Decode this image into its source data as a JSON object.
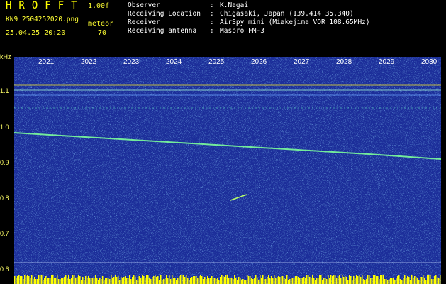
{
  "header": {
    "app_title": "HROFFT",
    "version": "1.00f",
    "filename": "KN9_2504252020.png",
    "meteor_label": "meteor",
    "datetime": "25.04.25 20:20",
    "meteor_count": "70"
  },
  "info": [
    {
      "key": "Observer",
      "sep": ":",
      "value": "K.Nagai"
    },
    {
      "key": "Receiving Location",
      "sep": ":",
      "value": "Chigasaki, Japan (139.414 35.340)"
    },
    {
      "key": "Receiver",
      "sep": ":",
      "value": "AirSpy mini (Miakejima VOR 108.65MHz)"
    },
    {
      "key": "Receiving antenna",
      "sep": ":",
      "value": "Maspro FM-3"
    }
  ],
  "axis": {
    "unit": "kHz",
    "y_ticks": [
      "1.1",
      "1.0",
      "0.9",
      "0.8",
      "0.7",
      "0.6"
    ],
    "x_ticks": [
      "2021",
      "2022",
      "2023",
      "2024",
      "2025",
      "2026",
      "2027",
      "2028",
      "2029",
      "2030"
    ]
  },
  "colors": {
    "background": "#000000",
    "waterfall_base": "#1b2f9a",
    "signal": "#7cff9a",
    "label_yellow": "#ffff33"
  }
}
